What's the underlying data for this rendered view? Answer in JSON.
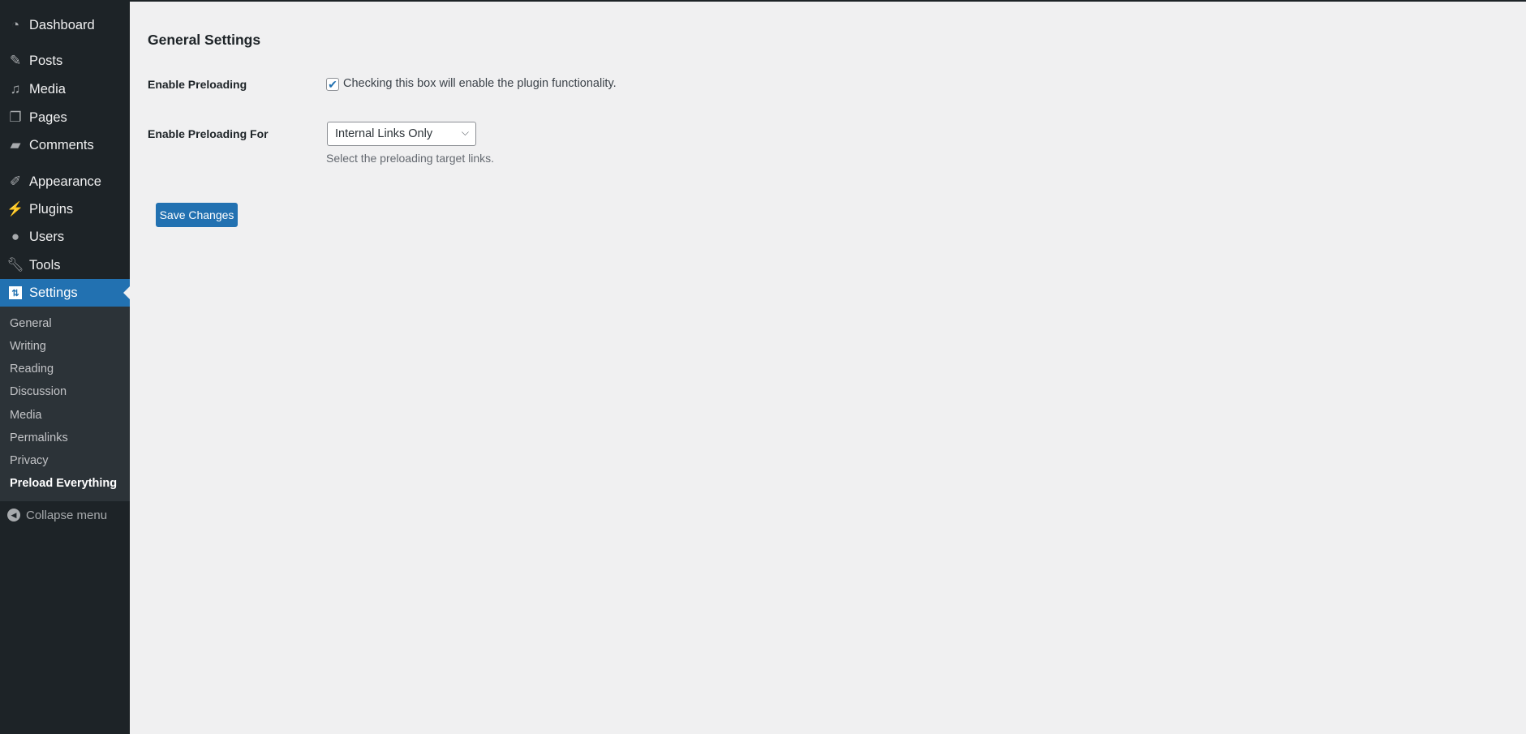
{
  "sidebar": {
    "menu": [
      {
        "label": "Dashboard",
        "icon": "dashboard-icon"
      },
      {
        "label": "Posts",
        "icon": "pin-icon"
      },
      {
        "label": "Media",
        "icon": "media-icon"
      },
      {
        "label": "Pages",
        "icon": "pages-icon"
      },
      {
        "label": "Comments",
        "icon": "comment-icon"
      },
      {
        "label": "Appearance",
        "icon": "brush-icon"
      },
      {
        "label": "Plugins",
        "icon": "plugin-icon"
      },
      {
        "label": "Users",
        "icon": "user-icon"
      },
      {
        "label": "Tools",
        "icon": "wrench-icon"
      },
      {
        "label": "Settings",
        "icon": "settings-icon",
        "active": true
      }
    ],
    "submenu": [
      "General",
      "Writing",
      "Reading",
      "Discussion",
      "Media",
      "Permalinks",
      "Privacy",
      "Preload Everything"
    ],
    "current_submenu": "Preload Everything",
    "collapse_label": "Collapse menu"
  },
  "main": {
    "title": "General Settings",
    "enable_label": "Enable Preloading",
    "enable_checked": true,
    "enable_text": "Checking this box will enable the plugin functionality.",
    "for_label": "Enable Preloading For",
    "for_value": "Internal Links Only",
    "for_description": "Select the preloading target links.",
    "save_label": "Save Changes"
  },
  "colors": {
    "accent": "#2271b1",
    "sidebar": "#1d2327",
    "submenu": "#2c3338",
    "background": "#f0f0f1"
  }
}
